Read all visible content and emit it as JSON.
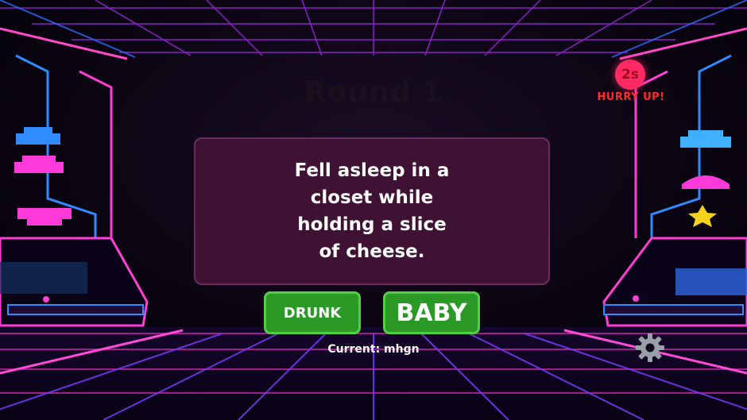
{
  "game": {
    "round_title": "Round 1",
    "timer": "2s",
    "hurry_text": "HURRY UP!",
    "prompt": "Fell asleep in a closet while holding a slice of cheese.",
    "buttons": {
      "left": "DRUNK",
      "right": "BABY"
    },
    "current_label": "Current: mhgn"
  },
  "icons": {
    "settings": "gear-icon"
  },
  "colors": {
    "card_bg": "#3f1234",
    "button_green": "#2a9926",
    "timer_red": "#ff2a63",
    "neon_pink": "#ff2fd0",
    "neon_blue": "#2f8bff"
  }
}
